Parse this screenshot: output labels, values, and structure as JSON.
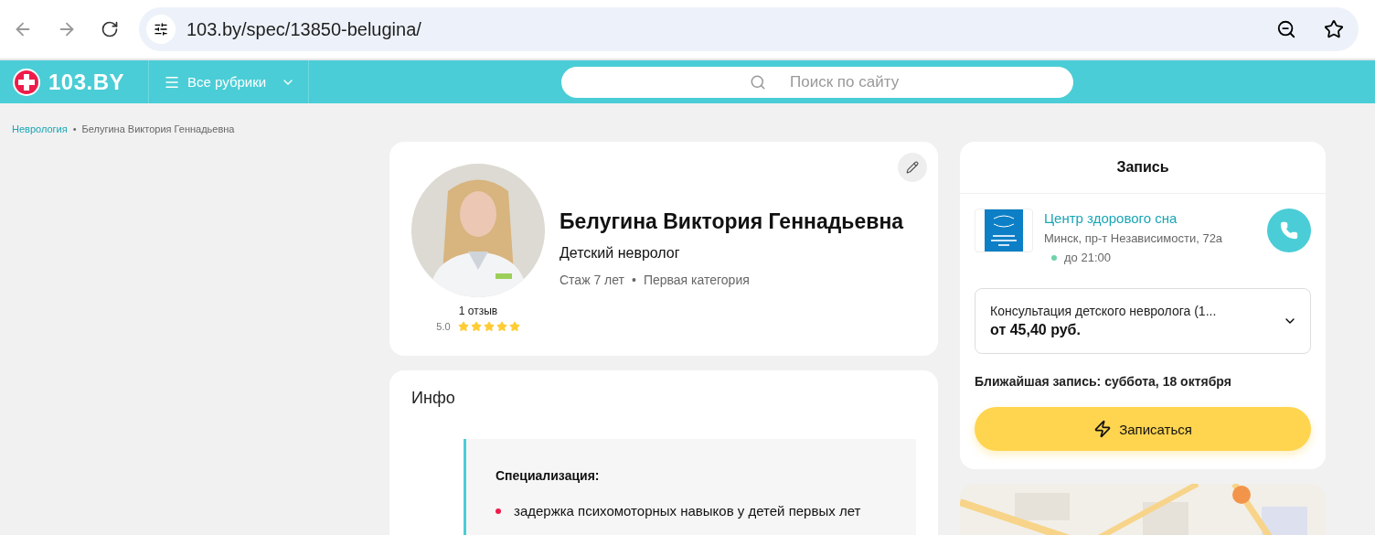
{
  "browser": {
    "url": "103.by/spec/13850-belugina/"
  },
  "header": {
    "logo": "103.BY",
    "menu_button": "Все рубрики",
    "search": {
      "placeholder": "Поиск по сайту"
    }
  },
  "breadcrumb_separator": "•",
  "details_separator": "•",
  "breadcrumbs": [
    {
      "label": "Неврология",
      "kind": "link"
    },
    {
      "label": "Белугина Виктория Геннадьевна",
      "kind": "current"
    }
  ],
  "profile": {
    "name": "Белугина Виктория Геннадьевна",
    "specialty": "Детский невролог",
    "details": [
      "Стаж 7 лет",
      "Первая категория"
    ],
    "reviews": "1 отзыв",
    "rating": "5.0",
    "stars": 5
  },
  "info": {
    "title": "Инфо",
    "section_title": "Специализация:",
    "items": [
      "задержка психомоторных навыков у детей первых лет"
    ]
  },
  "booking": {
    "title": "Запись",
    "clinic": {
      "name": "Центр здорового сна",
      "address": "Минск, пр-т Независимости, 72а",
      "hours": "до 21:00",
      "open": true
    },
    "service": {
      "name": "Консультация детского невролога (1...",
      "price": "от 45,40 руб."
    },
    "nearest": "Ближайшая запись: суббота, 18 октября",
    "button": "Записаться"
  }
}
